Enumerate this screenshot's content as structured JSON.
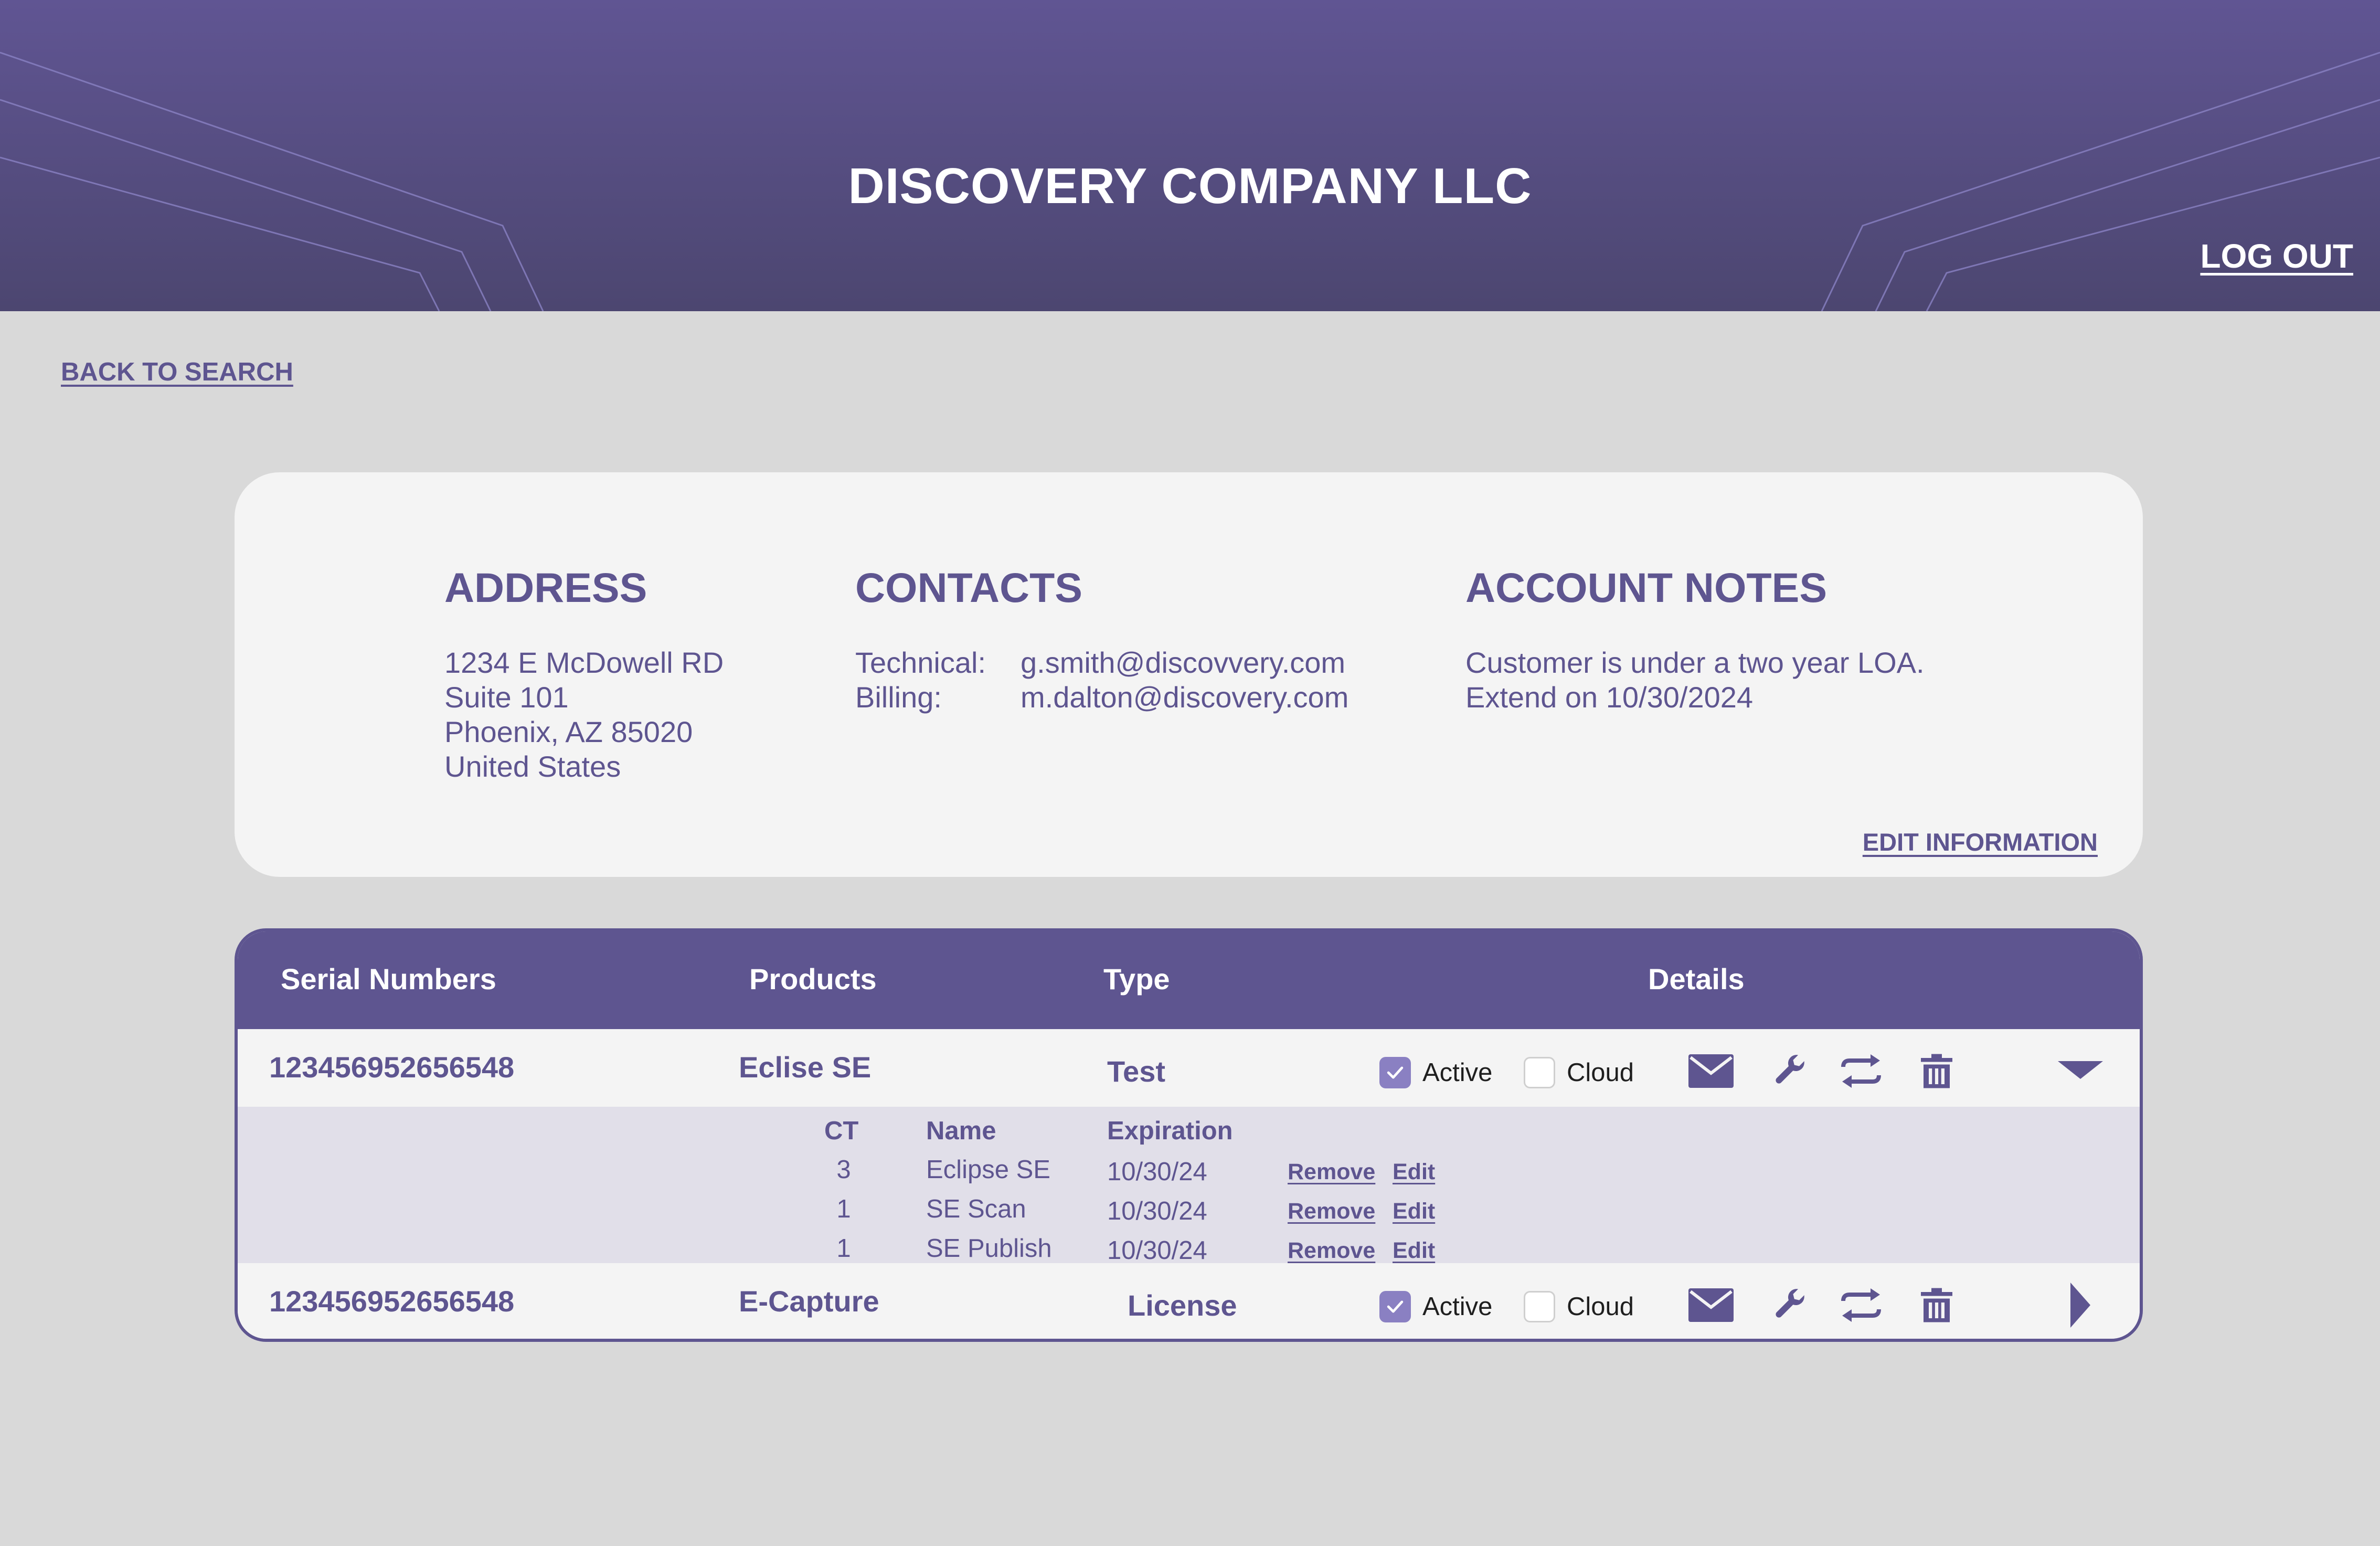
{
  "header": {
    "title": "DISCOVERY COMPANY LLC",
    "logout_label": "LOG OUT"
  },
  "nav": {
    "back_label": "BACK TO SEARCH"
  },
  "info": {
    "address": {
      "heading": "ADDRESS",
      "lines": [
        "1234 E McDowell RD",
        "Suite 101",
        "Phoenix, AZ 85020",
        "United States"
      ]
    },
    "contacts": {
      "heading": "CONTACTS",
      "items": [
        {
          "role": "Technical:",
          "email": "g.smith@discovvery.com"
        },
        {
          "role": "Billing:",
          "email": "m.dalton@discovery.com"
        }
      ]
    },
    "notes": {
      "heading": "ACCOUNT NOTES",
      "lines": [
        "Customer is under a two year LOA.",
        "Extend on 10/30/2024"
      ]
    },
    "edit_label": "EDIT INFORMATION"
  },
  "table": {
    "headers": {
      "serial": "Serial Numbers",
      "products": "Products",
      "type": "Type",
      "details": "Details"
    },
    "rows": [
      {
        "serial": "123456952656548",
        "product": "Eclise SE",
        "type": "Test",
        "active_label": "Active",
        "active": true,
        "cloud_label": "Cloud",
        "cloud": false,
        "expanded": true
      },
      {
        "serial": "123456952656548",
        "product": "E-Capture",
        "type": "License",
        "active_label": "Active",
        "active": true,
        "cloud_label": "Cloud",
        "cloud": false,
        "expanded": false
      }
    ],
    "subtable": {
      "headers": {
        "ct": "CT",
        "name": "Name",
        "expiration": "Expiration"
      },
      "rows": [
        {
          "ct": "3",
          "name": "Eclipse SE",
          "expiration": "10/30/24",
          "remove": "Remove",
          "edit": "Edit"
        },
        {
          "ct": "1",
          "name": "SE Scan",
          "expiration": "10/30/24",
          "remove": "Remove",
          "edit": "Edit"
        },
        {
          "ct": "1",
          "name": "SE Publish",
          "expiration": "10/30/24",
          "remove": "Remove",
          "edit": "Edit"
        }
      ]
    },
    "row_icons": [
      "mail-icon",
      "wrench-icon",
      "transfer-icon",
      "trash-icon"
    ]
  },
  "colors": {
    "brand": "#5e5590",
    "header_top": "#605593",
    "header_bottom": "#4c4670",
    "page_bg": "#d9d9d9",
    "card_bg": "#f4f4f4",
    "subtable_bg": "#e1dfe9",
    "checkbox": "#8a80c2"
  }
}
